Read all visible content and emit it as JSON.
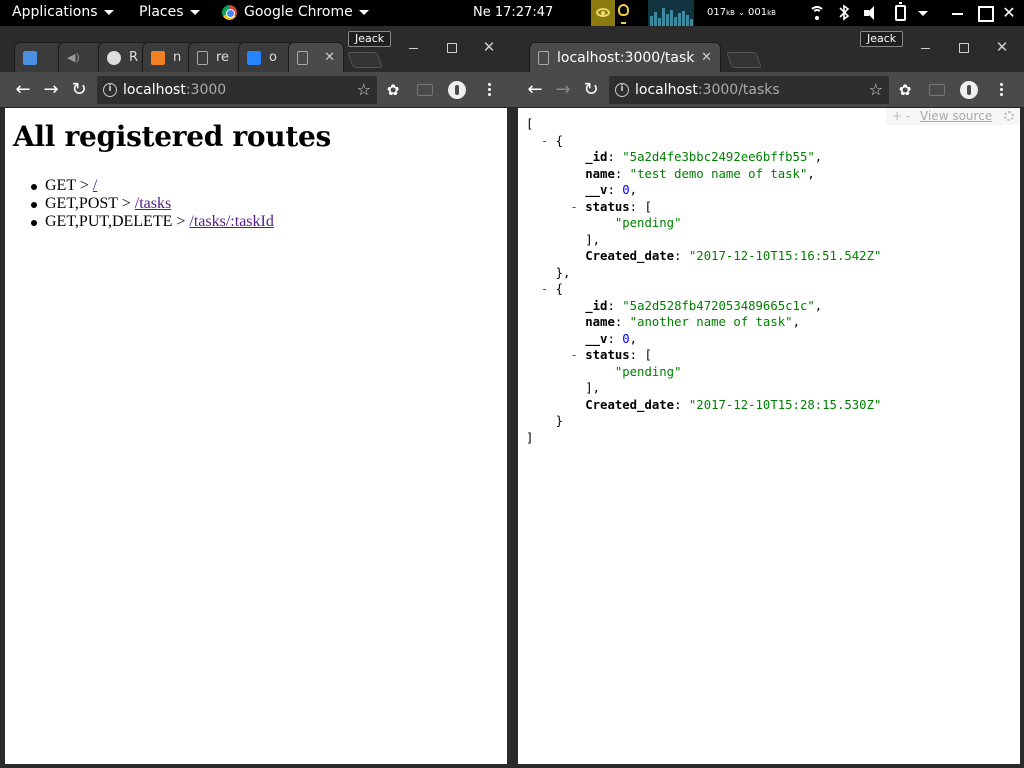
{
  "topbar": {
    "applications": "Applications",
    "places": "Places",
    "app_menu": "Google Chrome",
    "clock": "Ne 17:27:47",
    "net_down": "017",
    "net_up": "001",
    "net_unit": "kB"
  },
  "left_window": {
    "user_button": "Jeack",
    "tabs": [
      {
        "label": "",
        "favicon": "mail-check-icon",
        "color": "#4a90e2"
      },
      {
        "label": "",
        "favicon": "speaker-icon",
        "color": "#999999"
      },
      {
        "label": "R",
        "favicon": "github-icon",
        "color": "#dddddd"
      },
      {
        "label": "n",
        "favicon": "stackoverflow-icon",
        "color": "#f48024"
      },
      {
        "label": "re",
        "favicon": "page-icon",
        "color": "#aaaaaa"
      },
      {
        "label": "o",
        "favicon": "bitbucket-icon",
        "color": "#2684ff"
      },
      {
        "label": "",
        "favicon": "page-icon",
        "color": "#aaaaaa",
        "active": true
      }
    ],
    "url_host": "localhost",
    "url_port": ":3000",
    "page": {
      "heading": "All registered routes",
      "routes": [
        {
          "methods": "GET > ",
          "link": "/"
        },
        {
          "methods": "GET,POST > ",
          "link": "/tasks"
        },
        {
          "methods": "GET,PUT,DELETE > ",
          "link": "/tasks/:taskId"
        }
      ]
    }
  },
  "right_window": {
    "user_button": "Jeack",
    "tab_title": "localhost:3000/task",
    "url_host": "localhost",
    "url_path": ":3000/tasks",
    "viewer": {
      "plus": "+",
      "minus": "-",
      "view_source": "View source"
    },
    "json": [
      {
        "_id": "5a2d4fe3bbc2492ee6bffb55",
        "name": "test demo name of task",
        "__v": 0,
        "status": [
          "pending"
        ],
        "Created_date": "2017-12-10T15:16:51.542Z"
      },
      {
        "_id": "5a2d528fb472053489665c1c",
        "name": "another name of task",
        "__v": 0,
        "status": [
          "pending"
        ],
        "Created_date": "2017-12-10T15:28:15.530Z"
      }
    ]
  }
}
